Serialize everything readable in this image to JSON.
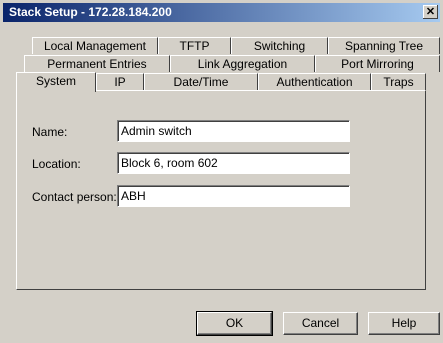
{
  "window": {
    "title": "Stack Setup - 172.28.184.200",
    "close_glyph": "✕"
  },
  "tabs": {
    "row1": [
      "Local Management",
      "TFTP",
      "Switching",
      "Spanning Tree"
    ],
    "row2": [
      "Permanent Entries",
      "Link Aggregation",
      "Port Mirroring"
    ],
    "row3": [
      "System",
      "IP",
      "Date/Time",
      "Authentication",
      "Traps"
    ],
    "active": "System"
  },
  "form": {
    "name_label": "Name:",
    "name_value": "Admin switch",
    "location_label": "Location:",
    "location_value": "Block 6, room 602",
    "contact_label": "Contact person:",
    "contact_value": "ABH"
  },
  "buttons": {
    "ok": "OK",
    "cancel": "Cancel",
    "help": "Help"
  }
}
